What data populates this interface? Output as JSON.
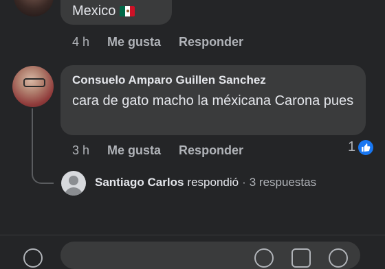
{
  "top_comment": {
    "text": "Mexico",
    "flag_icon": "mexico-flag-icon",
    "time": "4 h",
    "like_label": "Me gusta",
    "reply_label": "Responder"
  },
  "main_comment": {
    "author": "Consuelo Amparo Guillen Sanchez",
    "text": "cara de gato macho la méxicana Carona pues",
    "time": "3 h",
    "like_label": "Me gusta",
    "reply_label": "Responder",
    "reaction_count": "1",
    "reaction_icon": "thumbs-up-icon"
  },
  "reply_summary": {
    "author": "Santiago Carlos",
    "verb": "respondió",
    "separator": "·",
    "count_text": "3 respuestas"
  },
  "colors": {
    "background": "#242527",
    "bubble": "#3a3b3c",
    "text_primary": "#e4e6eb",
    "text_secondary": "#b0b3b8",
    "like_blue": "#1877f2"
  }
}
